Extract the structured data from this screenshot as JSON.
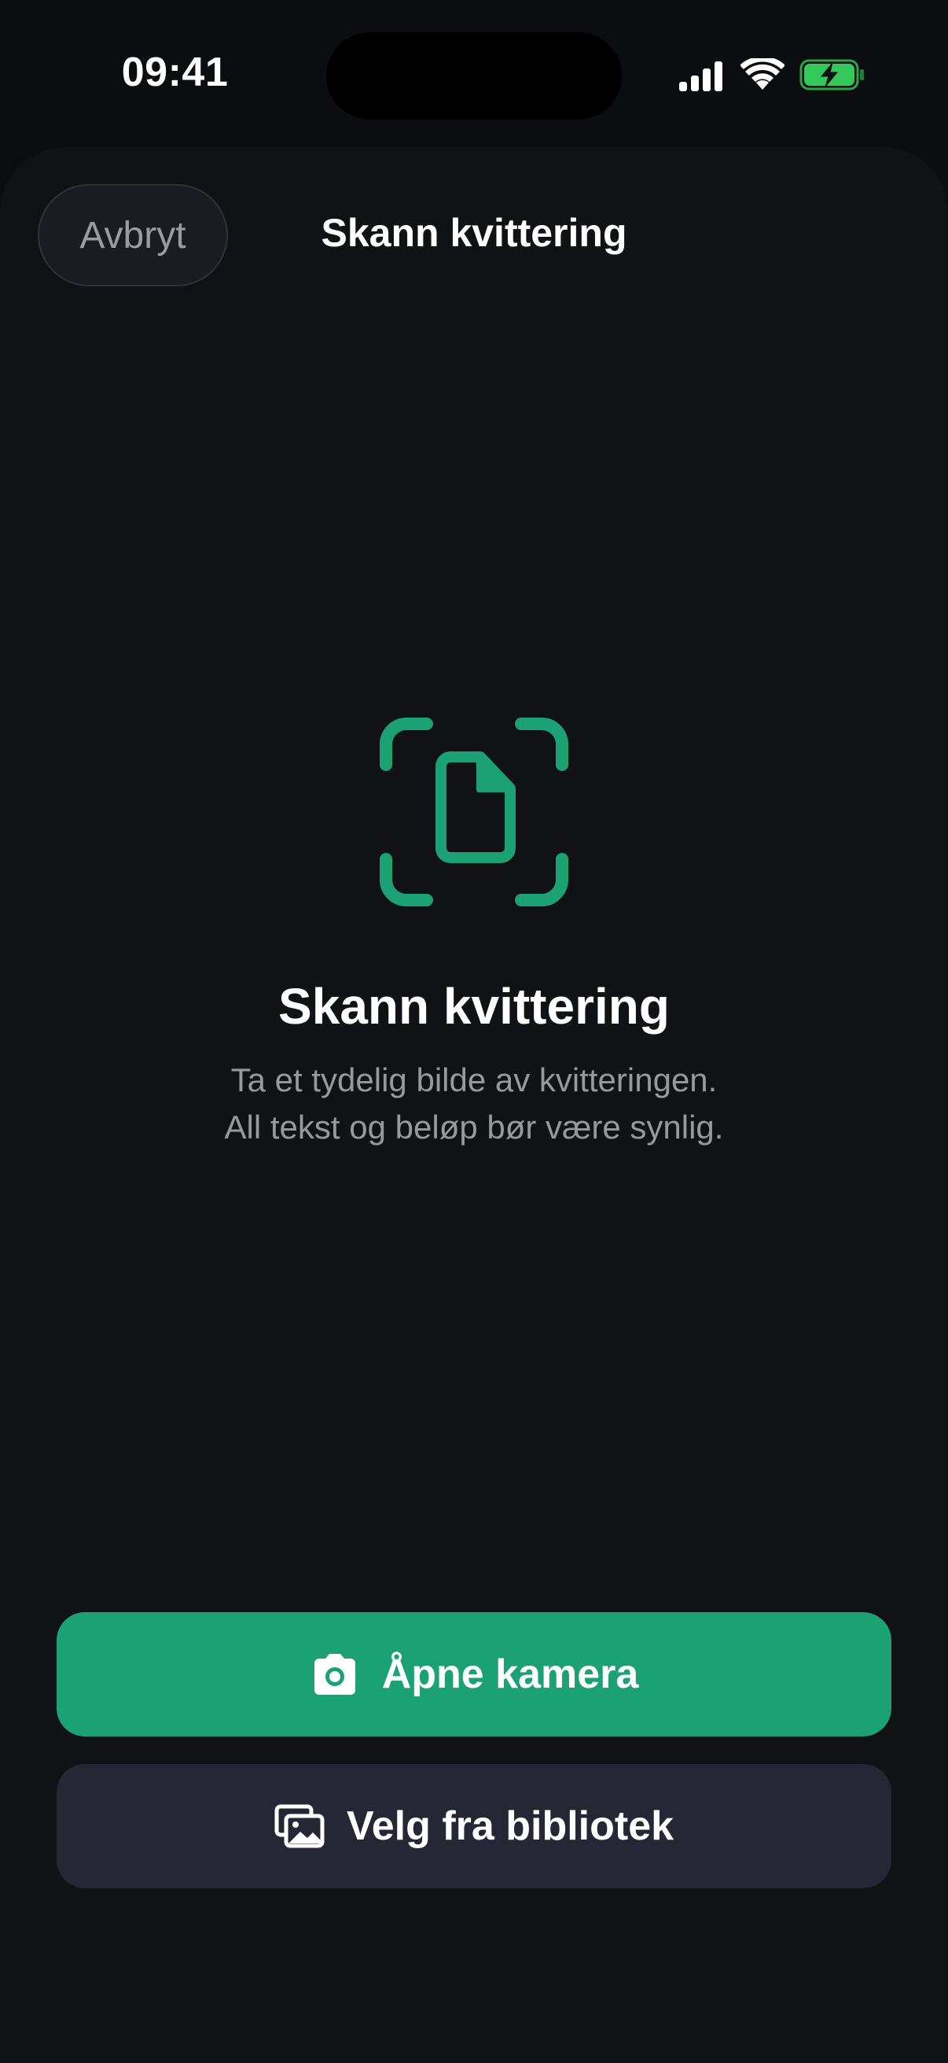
{
  "status_bar": {
    "time": "09:41",
    "icons": [
      "signal-icon",
      "wifi-icon",
      "battery-charging-icon"
    ],
    "battery_color": "#34c759"
  },
  "nav": {
    "cancel_label": "Avbryt",
    "title": "Skann kvittering"
  },
  "hero": {
    "icon": "document-scan-icon",
    "title": "Skann kvittering",
    "subtitle_line1": "Ta et tydelig bilde av kvitteringen.",
    "subtitle_line2": "All tekst og beløp bør være synlig."
  },
  "actions": {
    "camera": {
      "label": "Åpne kamera",
      "icon": "camera-icon"
    },
    "library": {
      "label": "Velg fra bibliotek",
      "icon": "photo-library-icon"
    }
  },
  "colors": {
    "accent": "#1ba173",
    "background": "#101216",
    "secondary_button": "#252834"
  }
}
